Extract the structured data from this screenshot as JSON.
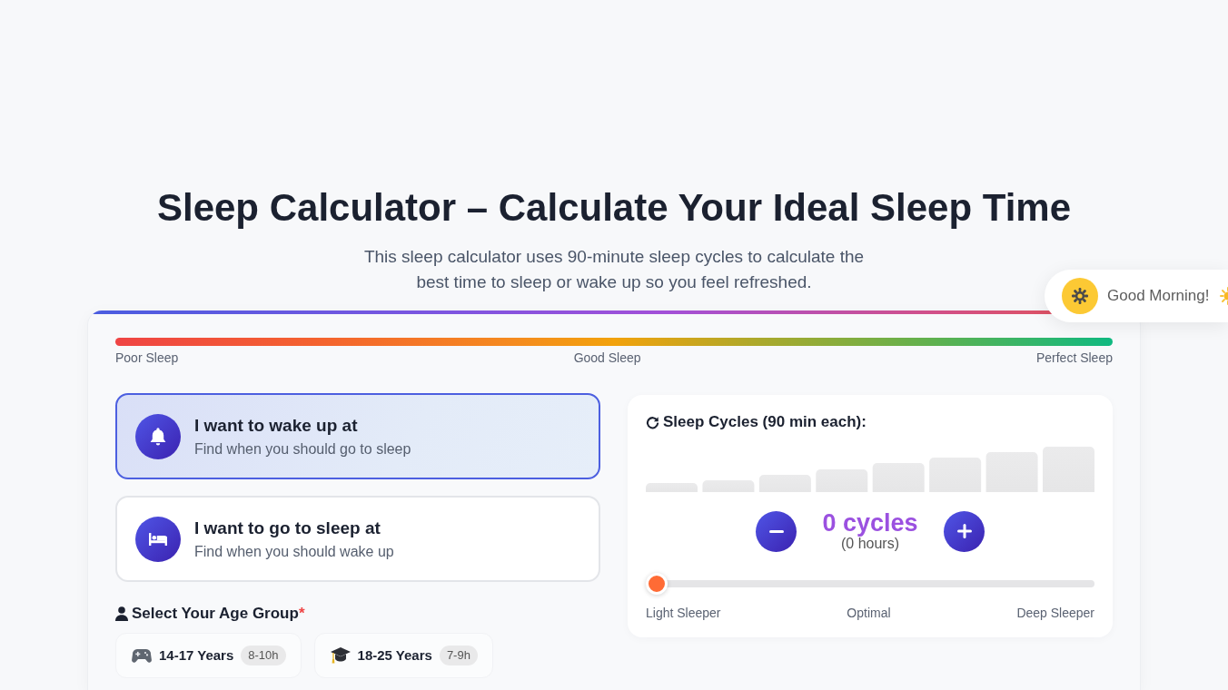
{
  "header": {
    "title": "Sleep Calculator – Calculate Your Ideal Sleep Time",
    "subtitle": "This sleep calculator uses 90-minute sleep cycles to calculate the best time to sleep or wake up so you feel refreshed."
  },
  "toast": {
    "text": "Good Morning!"
  },
  "quality_scale": {
    "labels": [
      "Poor Sleep",
      "Good Sleep",
      "Perfect Sleep"
    ]
  },
  "modes": [
    {
      "kind": "bell",
      "title": "I want to wake up at",
      "description": "Find when you should go to sleep",
      "selected": true
    },
    {
      "kind": "bed",
      "title": "I want to go to sleep at",
      "description": "Find when you should wake up",
      "selected": false
    }
  ],
  "age_group": {
    "label": "Select Your Age Group",
    "required_mark": "*",
    "options": [
      {
        "kind": "gamepad",
        "label": "14-17 Years",
        "hours": "8-10h",
        "selected": false
      },
      {
        "kind": "graduation-cap",
        "label": "18-25 Years",
        "hours": "7-9h",
        "selected": false
      }
    ]
  },
  "sleep_cycles": {
    "heading": "Sleep Cycles (90 min each):",
    "count": "0 cycles",
    "hours": "(0 hours)",
    "slider": {
      "level": 0,
      "labels": [
        "Light Sleeper",
        "Optimal",
        "Deep Sleeper"
      ]
    }
  }
}
